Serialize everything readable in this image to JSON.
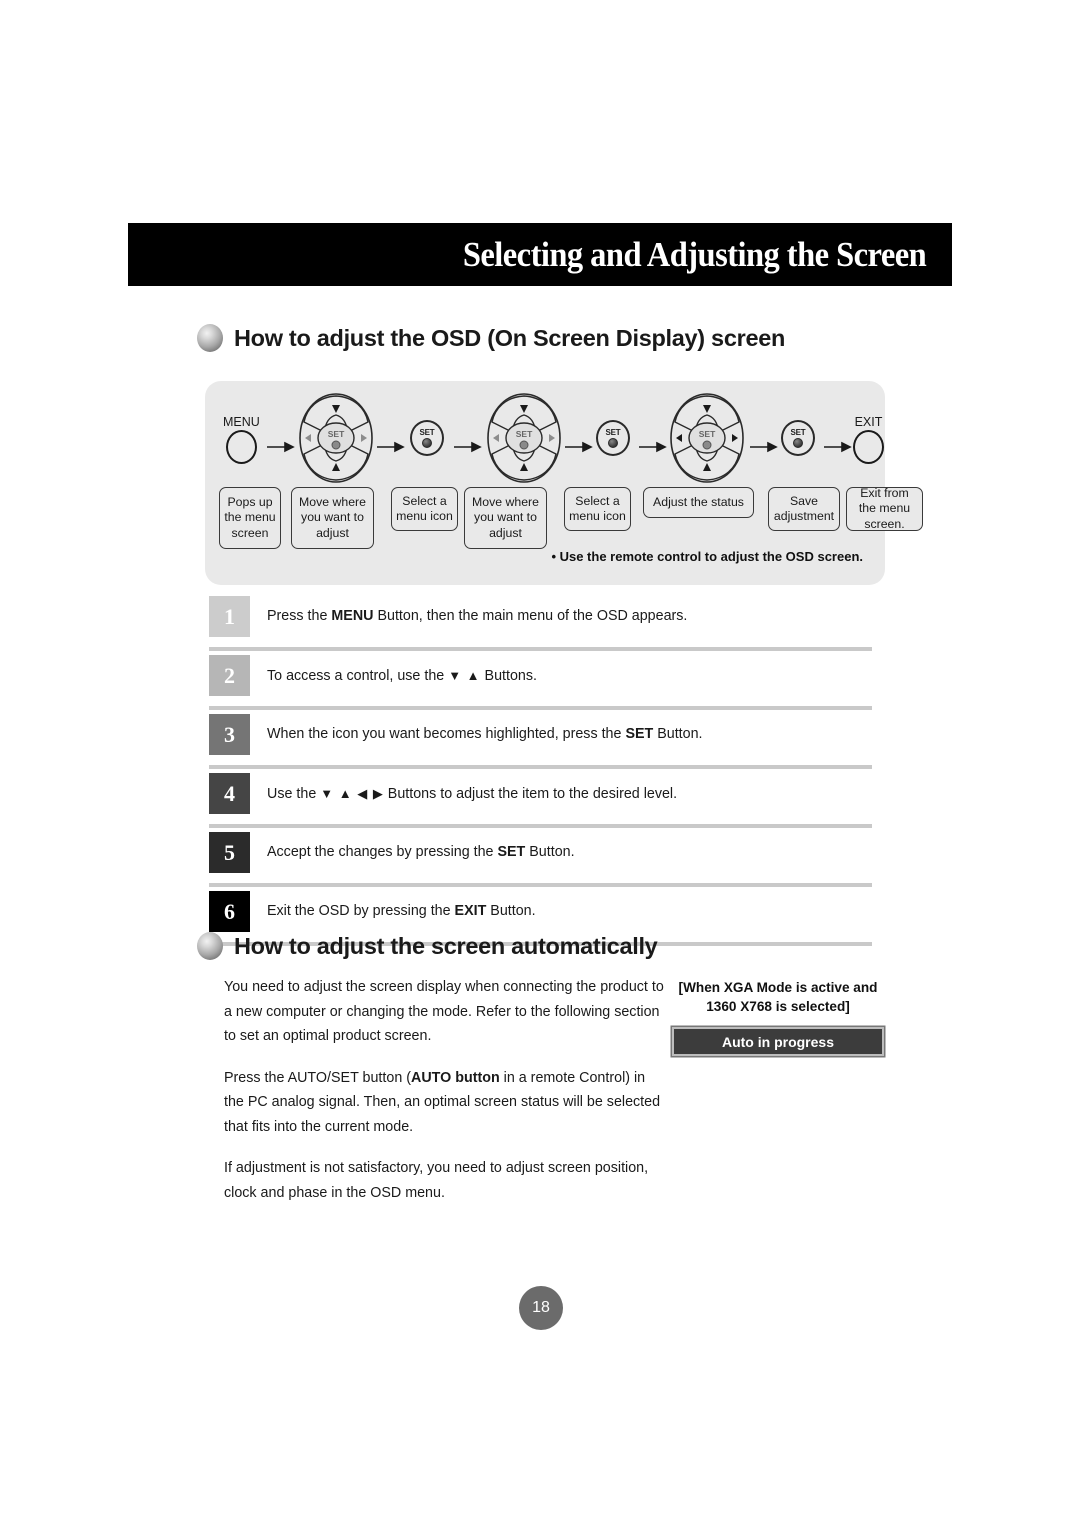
{
  "page": {
    "banner_title": "Selecting and Adjusting the Screen",
    "page_number": "18"
  },
  "sections": {
    "osd": {
      "heading": "How to adjust the OSD (On Screen Display) screen",
      "panel_note": "• Use the remote control to adjust the OSD screen."
    },
    "auto": {
      "heading": "How to adjust the screen automatically",
      "paragraph_1_a": "You need to adjust the screen display when connecting the product to a new computer or changing the mode. Refer to the following section to set an optimal product screen.",
      "paragraph_2_a": "Press the AUTO/SET button (",
      "paragraph_2_b": "AUTO button",
      "paragraph_2_c": " in a remote Control) in the PC analog signal. Then, an optimal screen status will be selected that fits into the current mode.",
      "paragraph_3_a": "If adjustment is not satisfactory, you need to adjust screen position, clock and phase in the OSD menu.",
      "side_note_line_1": "[When XGA Mode is active and",
      "side_note_line_2": "1360 X768 is selected]",
      "auto_progress_label": "Auto in progress"
    }
  },
  "diagram": {
    "buttons": {
      "menu_label": "MENU",
      "exit_label": "EXIT",
      "set_label": "SET"
    },
    "captions": [
      "Pops up the menu screen",
      "Move where you want to adjust",
      "Select a menu icon",
      "Move where you want to adjust",
      "Select a menu icon",
      "Adjust the status",
      "Save adjustment",
      "Exit from the menu screen."
    ]
  },
  "steps": [
    {
      "number": "1",
      "color": "#cccccc",
      "text_a": "Press the ",
      "text_b": "MENU",
      "text_c": " Button, then the main menu of the OSD appears."
    },
    {
      "number": "2",
      "color": "#b6b6b6",
      "text_a": "To access a control, use the ",
      "text_b": "▼ ▲",
      "text_c": " Buttons."
    },
    {
      "number": "3",
      "color": "#757575",
      "text_a": "When the icon you want becomes highlighted, press the ",
      "text_b": "SET",
      "text_c": " Button."
    },
    {
      "number": "4",
      "color": "#454545",
      "text_a": "Use the ",
      "text_b": "▼ ▲ ◀ ▶",
      "text_c": " Buttons to adjust the item to the desired level."
    },
    {
      "number": "5",
      "color": "#2b2b2b",
      "text_a": "Accept the changes by pressing the ",
      "text_b": "SET",
      "text_c": " Button."
    },
    {
      "number": "6",
      "color": "#000000",
      "text_a": "Exit the OSD by pressing the ",
      "text_b": "EXIT",
      "text_c": " Button."
    }
  ]
}
